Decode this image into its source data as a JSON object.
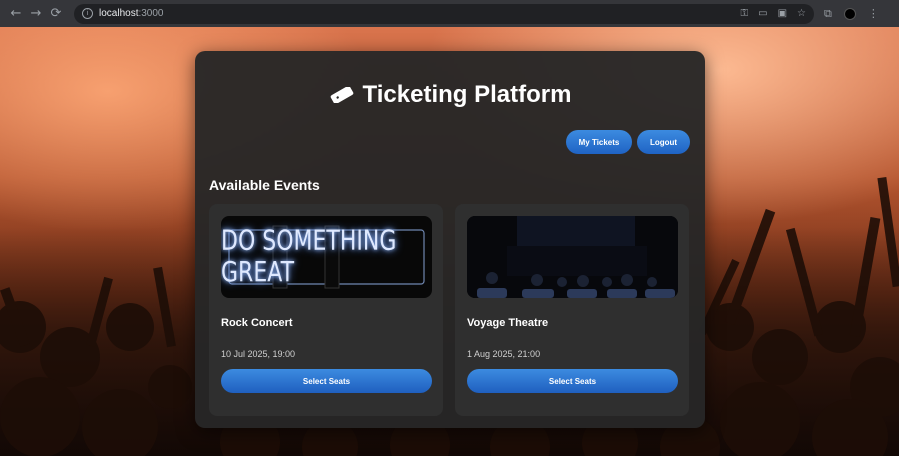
{
  "browser": {
    "url_host": "localhost",
    "url_port": ":3000"
  },
  "app": {
    "title": "Ticketing Platform",
    "my_tickets_label": "My Tickets",
    "logout_label": "Logout",
    "section_title": "Available Events"
  },
  "events": [
    {
      "name": "Rock Concert",
      "date": "10 Jul 2025, 19:00",
      "button_label": "Select Seats",
      "image_text": "DO SOMETHING GREAT",
      "image": "neon-sign"
    },
    {
      "name": "Voyage Theatre",
      "date": "1 Aug 2025, 21:00",
      "button_label": "Select Seats",
      "image": "theatre-audience"
    }
  ],
  "colors": {
    "accent": "#2f7ad6",
    "panel": "#262626",
    "card": "#2f2f2f"
  }
}
